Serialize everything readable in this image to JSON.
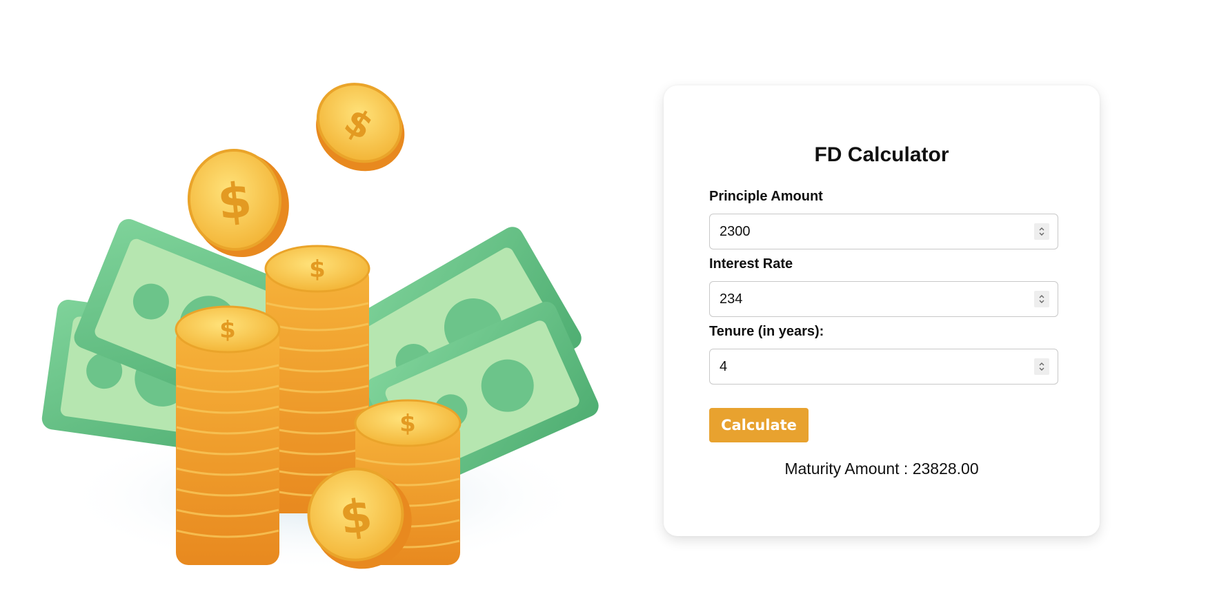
{
  "calculator": {
    "title": "FD Calculator",
    "fields": [
      {
        "label": "Principle Amount",
        "value": "2300"
      },
      {
        "label": "Interest Rate",
        "value": "234"
      },
      {
        "label": "Tenure (in years):",
        "value": "4"
      }
    ],
    "calculate_label": "Calculate",
    "result_label": "Maturity Amount : ",
    "result_value": "23828.00",
    "result_text": "Maturity Amount : 23828.00"
  },
  "theme": {
    "accent": "#e8a22f",
    "money_green": "#6cc48a",
    "coin_gold": "#f2b233"
  },
  "illustration": {
    "icon": "money-coins-illustration"
  }
}
